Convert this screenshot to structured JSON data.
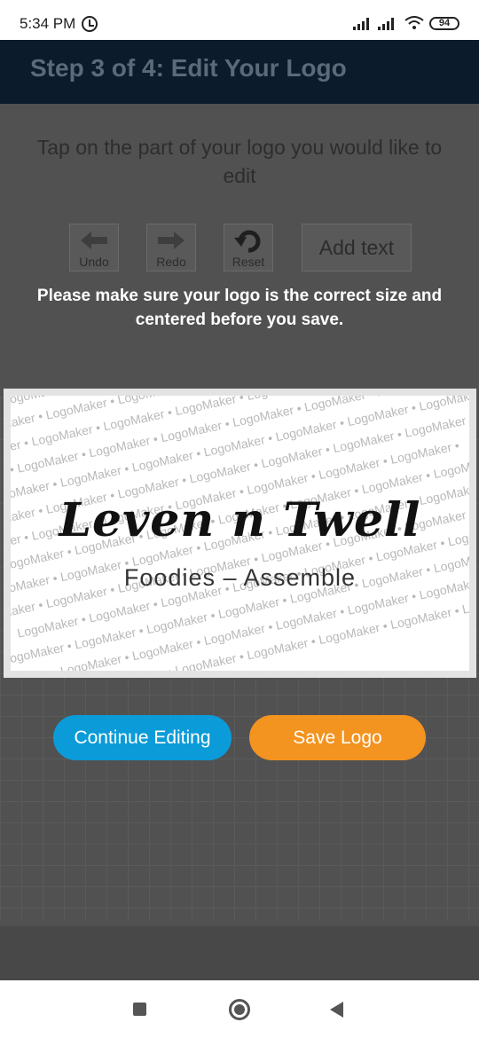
{
  "status_bar": {
    "time": "5:34 PM",
    "battery": "94",
    "icons": [
      "alarm-icon",
      "signal-icon",
      "signal-icon",
      "wifi-icon",
      "battery-icon"
    ]
  },
  "header": {
    "title": "Step 3 of 4: Edit Your Logo"
  },
  "instruction": "Tap on the part of your logo you would like to edit",
  "toolbar": {
    "undo_label": "Undo",
    "redo_label": "Redo",
    "reset_label": "Reset",
    "add_text_label": "Add text"
  },
  "overlay": {
    "message": "Please make sure your logo is the correct size and centered before you save."
  },
  "logo": {
    "name": "Leven n Twell",
    "tagline": "Foodies – Assemble",
    "watermark_text": "LogoMaker • LogoMaker • LogoMaker • LogoMaker • LogoMaker • LogoMaker • LogoMaker •"
  },
  "buttons": {
    "continue_label": "Continue Editing",
    "save_label": "Save Logo"
  },
  "colors": {
    "header_bg": "#0b1b2c",
    "continue_bg": "#0b9bd8",
    "save_bg": "#f39320",
    "overlay_bg": "#515151"
  },
  "nav_bar": {
    "icons": [
      "recent-apps-icon",
      "home-icon",
      "back-icon"
    ]
  }
}
